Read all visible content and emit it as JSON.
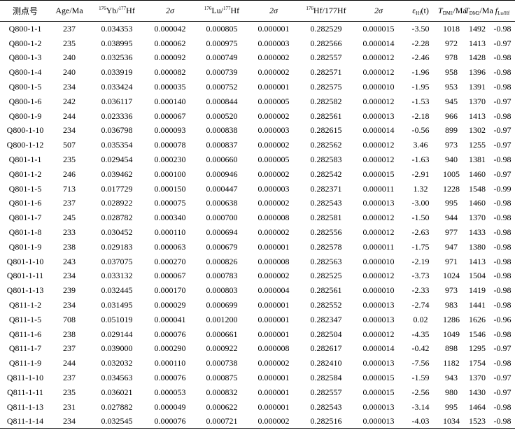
{
  "table": {
    "headers": {
      "sample": "测点号",
      "age": "Age/Ma",
      "yb_hf": {
        "sup1": "176",
        "mid": "Yb/",
        "sup2": "177",
        "end": "Hf"
      },
      "sigma1": "2σ",
      "lu_hf": {
        "sup1": "176",
        "mid": "Lu/",
        "sup2": "177",
        "end": "Hf"
      },
      "sigma2": "2σ",
      "hf_hf": {
        "sup1": "176",
        "end": "Hf/177Hf"
      },
      "sigma3": "2σ",
      "ehf": {
        "main": "ε",
        "sub": "Hf",
        "end": "(t)"
      },
      "tdm1": {
        "main": "T",
        "sub": "DM1",
        "end": "/Ma"
      },
      "tdm2": {
        "main": "T",
        "sub": "DM2",
        "end": "/Ma"
      },
      "flu": {
        "main": "f",
        "sub": "Lu/Hf"
      }
    },
    "rows": [
      [
        "Q800-1-1",
        "237",
        "0.034353",
        "0.000042",
        "0.000805",
        "0.000001",
        "0.282529",
        "0.000015",
        "-3.50",
        "1018",
        "1492",
        "-0.98"
      ],
      [
        "Q800-1-2",
        "235",
        "0.038995",
        "0.000062",
        "0.000975",
        "0.000003",
        "0.282566",
        "0.000014",
        "-2.28",
        "972",
        "1413",
        "-0.97"
      ],
      [
        "Q800-1-3",
        "240",
        "0.032536",
        "0.000092",
        "0.000749",
        "0.000002",
        "0.282557",
        "0.000012",
        "-2.46",
        "978",
        "1428",
        "-0.98"
      ],
      [
        "Q800-1-4",
        "240",
        "0.033919",
        "0.000082",
        "0.000739",
        "0.000002",
        "0.282571",
        "0.000012",
        "-1.96",
        "958",
        "1396",
        "-0.98"
      ],
      [
        "Q800-1-5",
        "234",
        "0.033424",
        "0.000035",
        "0.000752",
        "0.000001",
        "0.282575",
        "0.000010",
        "-1.95",
        "953",
        "1391",
        "-0.98"
      ],
      [
        "Q800-1-6",
        "242",
        "0.036117",
        "0.000140",
        "0.000844",
        "0.000005",
        "0.282582",
        "0.000012",
        "-1.53",
        "945",
        "1370",
        "-0.97"
      ],
      [
        "Q800-1-9",
        "244",
        "0.023336",
        "0.000067",
        "0.000520",
        "0.000002",
        "0.282561",
        "0.000013",
        "-2.18",
        "966",
        "1413",
        "-0.98"
      ],
      [
        "Q800-1-10",
        "234",
        "0.036798",
        "0.000093",
        "0.000838",
        "0.000003",
        "0.282615",
        "0.000014",
        "-0.56",
        "899",
        "1302",
        "-0.97"
      ],
      [
        "Q800-1-12",
        "507",
        "0.035354",
        "0.000078",
        "0.000837",
        "0.000002",
        "0.282562",
        "0.000012",
        "3.46",
        "973",
        "1255",
        "-0.97"
      ],
      [
        "Q801-1-1",
        "235",
        "0.029454",
        "0.000230",
        "0.000660",
        "0.000005",
        "0.282583",
        "0.000012",
        "-1.63",
        "940",
        "1381",
        "-0.98"
      ],
      [
        "Q801-1-2",
        "246",
        "0.039462",
        "0.000100",
        "0.000946",
        "0.000002",
        "0.282542",
        "0.000015",
        "-2.91",
        "1005",
        "1460",
        "-0.97"
      ],
      [
        "Q801-1-5",
        "713",
        "0.017729",
        "0.000150",
        "0.000447",
        "0.000003",
        "0.282371",
        "0.000011",
        "1.32",
        "1228",
        "1548",
        "-0.99"
      ],
      [
        "Q801-1-6",
        "237",
        "0.028922",
        "0.000075",
        "0.000638",
        "0.000002",
        "0.282543",
        "0.000013",
        "-3.00",
        "995",
        "1460",
        "-0.98"
      ],
      [
        "Q801-1-7",
        "245",
        "0.028782",
        "0.000340",
        "0.000700",
        "0.000008",
        "0.282581",
        "0.000012",
        "-1.50",
        "944",
        "1370",
        "-0.98"
      ],
      [
        "Q801-1-8",
        "233",
        "0.030452",
        "0.000110",
        "0.000694",
        "0.000002",
        "0.282556",
        "0.000012",
        "-2.63",
        "977",
        "1433",
        "-0.98"
      ],
      [
        "Q801-1-9",
        "238",
        "0.029183",
        "0.000063",
        "0.000679",
        "0.000001",
        "0.282578",
        "0.000011",
        "-1.75",
        "947",
        "1380",
        "-0.98"
      ],
      [
        "Q801-1-10",
        "243",
        "0.037075",
        "0.000270",
        "0.000826",
        "0.000008",
        "0.282563",
        "0.000010",
        "-2.19",
        "971",
        "1413",
        "-0.98"
      ],
      [
        "Q801-1-11",
        "234",
        "0.033132",
        "0.000067",
        "0.000783",
        "0.000002",
        "0.282525",
        "0.000012",
        "-3.73",
        "1024",
        "1504",
        "-0.98"
      ],
      [
        "Q801-1-13",
        "239",
        "0.032445",
        "0.000170",
        "0.000803",
        "0.000004",
        "0.282561",
        "0.000010",
        "-2.33",
        "973",
        "1419",
        "-0.98"
      ],
      [
        "Q811-1-2",
        "234",
        "0.031495",
        "0.000029",
        "0.000699",
        "0.000001",
        "0.282552",
        "0.000013",
        "-2.74",
        "983",
        "1441",
        "-0.98"
      ],
      [
        "Q811-1-5",
        "708",
        "0.051019",
        "0.000041",
        "0.001200",
        "0.000001",
        "0.282347",
        "0.000013",
        "0.02",
        "1286",
        "1626",
        "-0.96"
      ],
      [
        "Q811-1-6",
        "238",
        "0.029144",
        "0.000076",
        "0.000661",
        "0.000001",
        "0.282504",
        "0.000012",
        "-4.35",
        "1049",
        "1546",
        "-0.98"
      ],
      [
        "Q811-1-7",
        "237",
        "0.039000",
        "0.000290",
        "0.000922",
        "0.000008",
        "0.282617",
        "0.000014",
        "-0.42",
        "898",
        "1295",
        "-0.97"
      ],
      [
        "Q811-1-9",
        "244",
        "0.032032",
        "0.000110",
        "0.000738",
        "0.000002",
        "0.282410",
        "0.000013",
        "-7.56",
        "1182",
        "1754",
        "-0.98"
      ],
      [
        "Q811-1-10",
        "237",
        "0.034563",
        "0.000076",
        "0.000875",
        "0.000001",
        "0.282584",
        "0.000015",
        "-1.59",
        "943",
        "1370",
        "-0.97"
      ],
      [
        "Q811-1-11",
        "235",
        "0.036021",
        "0.000053",
        "0.000832",
        "0.000001",
        "0.282557",
        "0.000015",
        "-2.56",
        "980",
        "1430",
        "-0.97"
      ],
      [
        "Q811-1-13",
        "231",
        "0.027882",
        "0.000049",
        "0.000622",
        "0.000001",
        "0.282543",
        "0.000013",
        "-3.14",
        "995",
        "1464",
        "-0.98"
      ],
      [
        "Q811-1-14",
        "234",
        "0.032545",
        "0.000076",
        "0.000721",
        "0.000002",
        "0.282516",
        "0.000013",
        "-4.03",
        "1034",
        "1523",
        "-0.98"
      ]
    ]
  }
}
